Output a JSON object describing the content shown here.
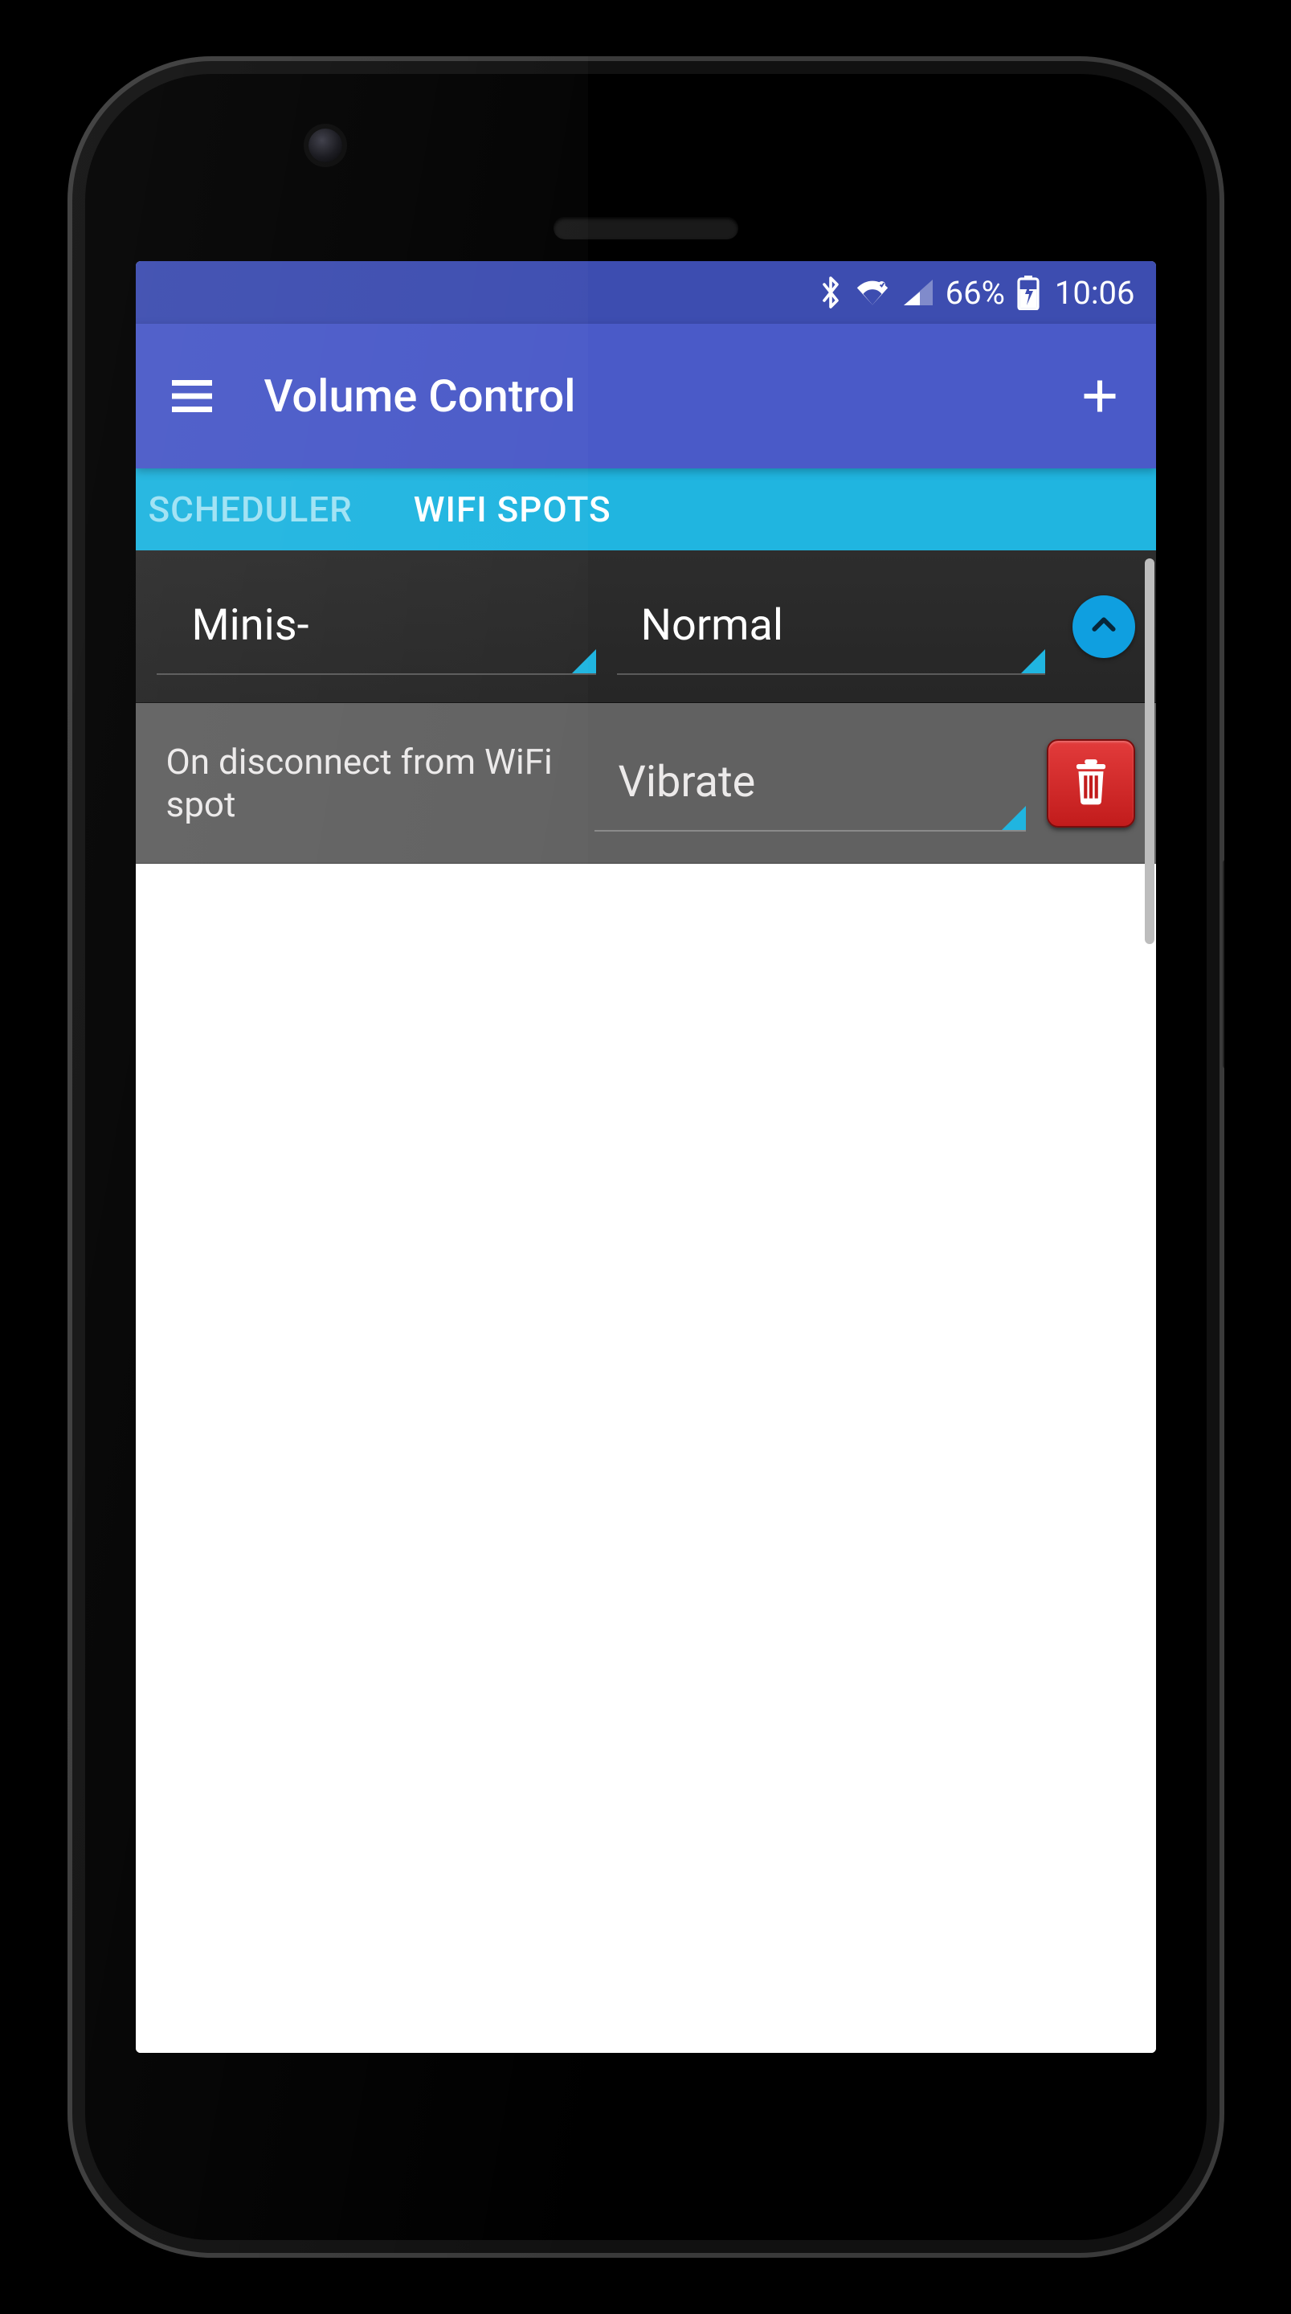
{
  "status_bar": {
    "battery_text": "66%",
    "time": "10:06"
  },
  "app_bar": {
    "title": "Volume Control"
  },
  "tabs": {
    "scheduler": "SCHEDULER",
    "wifi_spots": "WIFI SPOTS"
  },
  "row1": {
    "spot_name": "Minis-",
    "profile": "Normal"
  },
  "row2": {
    "label": "On disconnect from WiFi spot",
    "profile": "Vibrate"
  }
}
